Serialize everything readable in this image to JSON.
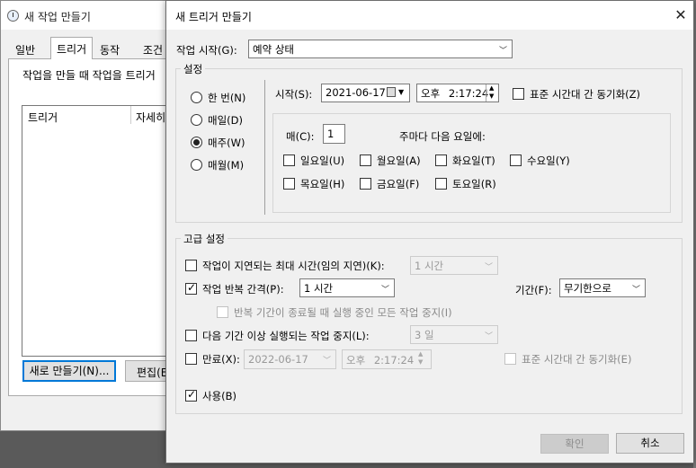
{
  "background_window": {
    "title": "새 작업 만들기",
    "tabs": [
      "일반",
      "트리거",
      "동작",
      "조건"
    ],
    "description": "작업을 만들 때 작업을 트리거",
    "list_columns": [
      "트리거",
      "자세히"
    ],
    "new_button": "새로 만들기(N)...",
    "edit_button": "편집(E)"
  },
  "dialog": {
    "title": "새 트리거 만들기",
    "close_glyph": "✕",
    "begin_task_label": "작업 시작(G):",
    "begin_task_value": "예약 상태",
    "settings": {
      "group_title": "설정",
      "radios": [
        "한 번(N)",
        "매일(D)",
        "매주(W)",
        "매월(M)"
      ],
      "selected_radio": "매주(W)",
      "start_label": "시작(S):",
      "start_date": "2021-06-17",
      "start_ampm": "오후",
      "start_time": "2:17:24",
      "sync_label": "표준 시간대 간 동기화(Z)",
      "every_label": "매(C):",
      "every_value": "1",
      "weeks_on_label": "주마다 다음 요일에:",
      "days": [
        [
          "일요일(U)",
          "월요일(A)",
          "화요일(T)",
          "수요일(Y)"
        ],
        [
          "목요일(H)",
          "금요일(F)",
          "토요일(R)"
        ]
      ]
    },
    "advanced": {
      "group_title": "고급 설정",
      "delay_label": "작업이 지연되는 최대 시간(임의 지연)(K):",
      "delay_value": "1 시간",
      "repeat_label": "작업 반복 간격(P):",
      "repeat_value": "1 시간",
      "duration_label": "기간(F):",
      "duration_value": "무기한으로",
      "stop_at_end_label": "반복 기간이 종료될 때 실행 중인 모든 작업 중지(I)",
      "stop_longer_label": "다음 기간 이상 실행되는 작업 중지(L):",
      "stop_longer_value": "3 일",
      "expire_label": "만료(X):",
      "expire_date": "2022-06-17",
      "expire_ampm": "오후",
      "expire_time": "2:17:24",
      "expire_sync_label": "표준 시간대 간 동기화(E)",
      "enabled_label": "사용(B)"
    },
    "ok_button": "확인",
    "cancel_button": "취소"
  },
  "colors": {
    "focus_blue": "#0078d7",
    "dialog_bg": "#f0f0f0",
    "desktop": "#5a5a5a"
  }
}
